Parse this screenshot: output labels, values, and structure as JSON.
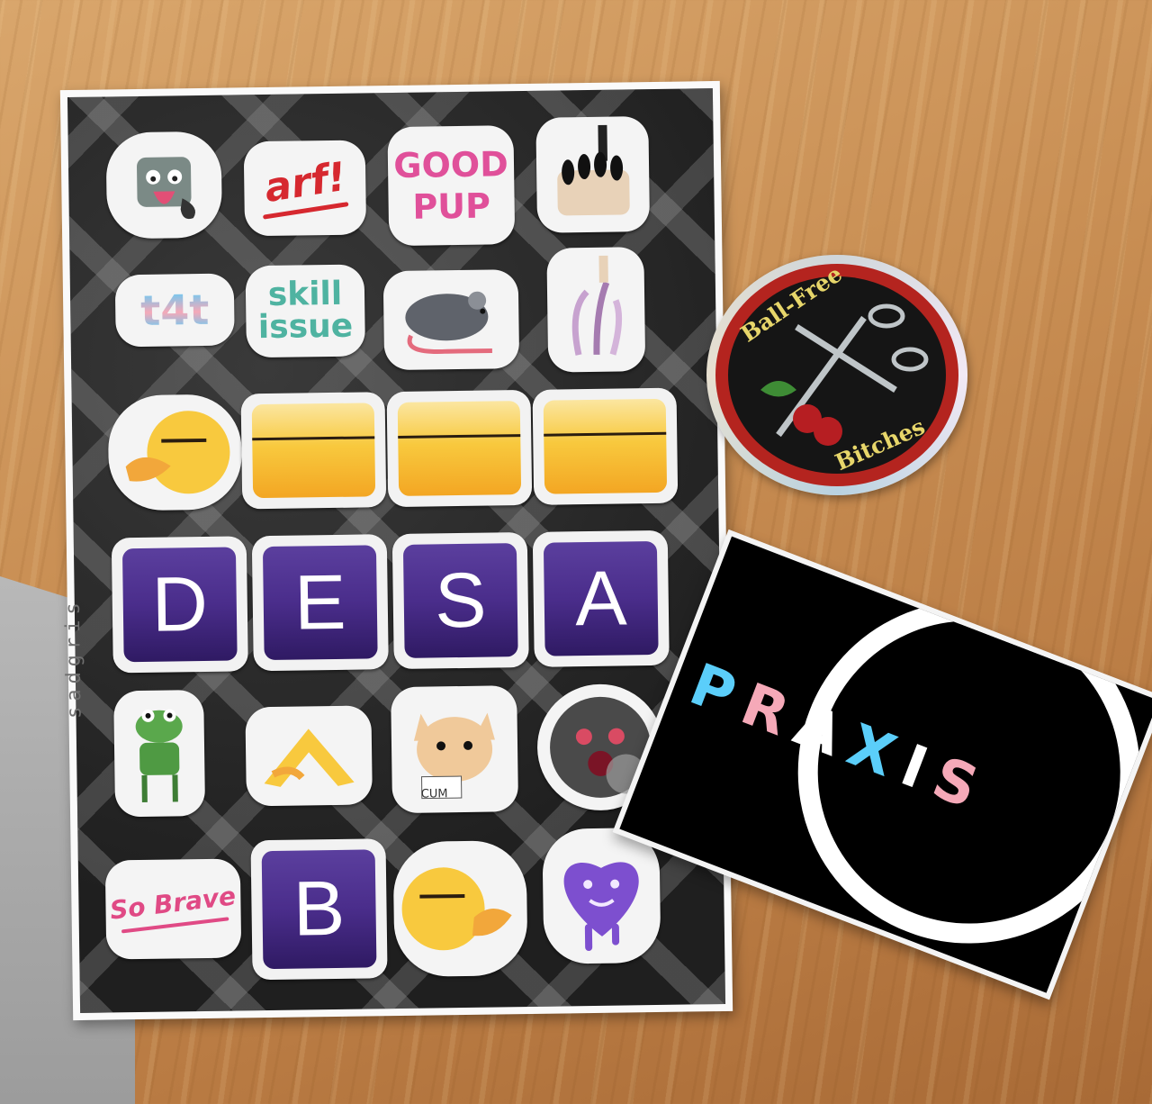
{
  "sheet": {
    "watermark": "sadgris",
    "row1": {
      "arf": "arf!",
      "good_pup_line1": "GOOD",
      "good_pup_line2": "PUP"
    },
    "row2": {
      "t4t": "t4t",
      "skill_issue_line1": "skill",
      "skill_issue_line2": "issue"
    },
    "tiles": [
      "D",
      "E",
      "S",
      "A"
    ],
    "row5": {
      "cum_label": "CUM"
    },
    "row6": {
      "so_brave": "So Brave",
      "b_tile": "B"
    }
  },
  "ballfree_sticker": {
    "top_text": "Ball-Free",
    "bottom_text": "Bitches"
  },
  "praxis_sticker": {
    "letters": [
      "P",
      "R",
      "A",
      "X",
      "I",
      "S"
    ],
    "colors": {
      "light_blue": "#5bcefa",
      "pink": "#f5a9b8",
      "white": "#ffffff"
    }
  }
}
